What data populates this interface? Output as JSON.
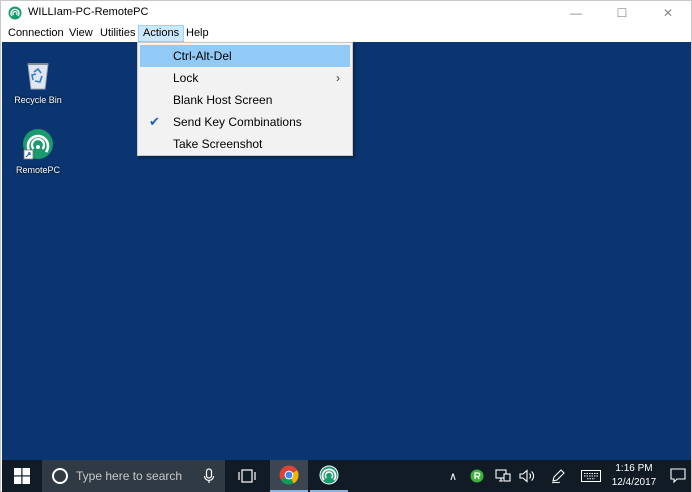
{
  "window": {
    "title": "WILLIam-PC-RemotePC",
    "controls": {
      "minimize": "—",
      "maximize": "☐",
      "close": "✕"
    }
  },
  "menubar": {
    "items": [
      "Connection",
      "View",
      "Utilities",
      "Actions",
      "Help"
    ],
    "active": "Actions"
  },
  "actions_menu": {
    "items": [
      {
        "label": "Ctrl-Alt-Del",
        "highlighted": true
      },
      {
        "label": "Lock",
        "submenu": true
      },
      {
        "label": "Blank Host Screen"
      },
      {
        "label": "Send Key Combinations",
        "checked": true
      },
      {
        "label": "Take Screenshot"
      }
    ],
    "check_glyph": "✔",
    "submenu_glyph": "›"
  },
  "desktop": {
    "background": "#0a3570",
    "icons": [
      {
        "label": "Recycle Bin",
        "icon": "recycle-bin-icon"
      },
      {
        "label": "RemotePC",
        "icon": "remotepc-icon"
      }
    ]
  },
  "taskbar": {
    "search_placeholder": "Type here to search",
    "pinned": [
      "chrome-icon",
      "remotepc-icon"
    ],
    "tray": {
      "chevron": "∧",
      "volume": "🔊"
    },
    "clock": {
      "time": "1:16 PM",
      "date": "12/4/2017"
    }
  },
  "colors": {
    "accent": "#91c9f7",
    "menu_active_bg": "#cce8ff",
    "taskbar_bg": "#101b26",
    "remotepc_green": "#1a9b6c"
  }
}
